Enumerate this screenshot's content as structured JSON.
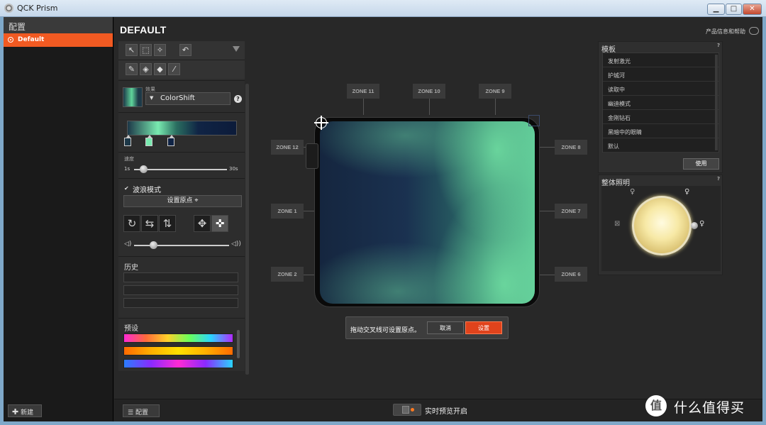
{
  "window": {
    "title": "QCK Prism",
    "min": "▁",
    "max": "□",
    "close": "✕"
  },
  "sidebar": {
    "header": "配置",
    "items": [
      {
        "label": "Default"
      }
    ],
    "new_button": "新建"
  },
  "page_title": "DEFAULT",
  "product_info": "产品信息和帮助",
  "tools": {
    "effect_label": "效果",
    "effect_value": "ColorShift",
    "help": "?",
    "speed_label": "速度",
    "speed_min": "1s",
    "speed_max": "30s",
    "speed_value": 0.1,
    "wave_mode_label": "波浪模式",
    "wave_mode_checked": "✔",
    "set_origin_label": "设置原点 ⌖",
    "volume_value": 0.2,
    "history_label": "历史",
    "presets_label": "预设"
  },
  "zones": {
    "z11": "ZONE 11",
    "z10": "ZONE 10",
    "z9": "ZONE 9",
    "z12": "ZONE 12",
    "z8": "ZONE 8",
    "z1": "ZONE 1",
    "z7": "ZONE 7",
    "z2": "ZONE 2",
    "z6": "ZONE 6"
  },
  "origin_tip": {
    "text": "拖动交叉线可设置原点。",
    "cancel": "取消",
    "confirm": "设置"
  },
  "templates": {
    "title": "模板",
    "help": "?",
    "items": [
      "发射激光",
      "护城河",
      "读取中",
      "幽迪模式",
      "金刚钻石",
      "黑暗中的眼睛",
      "默认"
    ],
    "use_button": "使用"
  },
  "lighting": {
    "title": "整体照明",
    "help": "?"
  },
  "footer": {
    "config_button": "配置",
    "live_preview": "实时预览开启"
  },
  "watermark": {
    "logo": "值",
    "text": "什么值得买"
  },
  "colors": {
    "accent": "#f15a22",
    "panel": "#2d2d2d"
  }
}
